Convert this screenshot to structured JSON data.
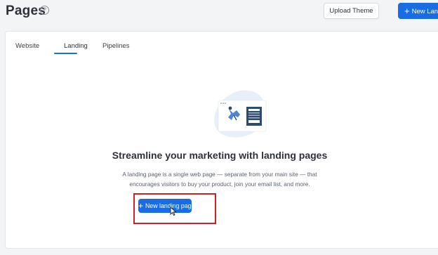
{
  "header": {
    "title": "Pages",
    "help_icon": "question-circle-icon",
    "upload_theme_label": "Upload Theme",
    "new_landing_label": "New Landing page"
  },
  "tabs": [
    {
      "label": "Website",
      "active": false
    },
    {
      "label": "Landing",
      "active": true
    },
    {
      "label": "Pipelines",
      "active": false
    }
  ],
  "empty_state": {
    "headline": "Streamline your marketing with landing pages",
    "description_line1": "A landing page is a single web page — separate from your main site — that",
    "description_line2": "encourages visitors to buy your product, join your email list, and more.",
    "button_label": "New landing page"
  },
  "colors": {
    "accent": "#1a6ce3",
    "highlight": "#d11f2a",
    "illustration_blob": "#e7eff9"
  }
}
